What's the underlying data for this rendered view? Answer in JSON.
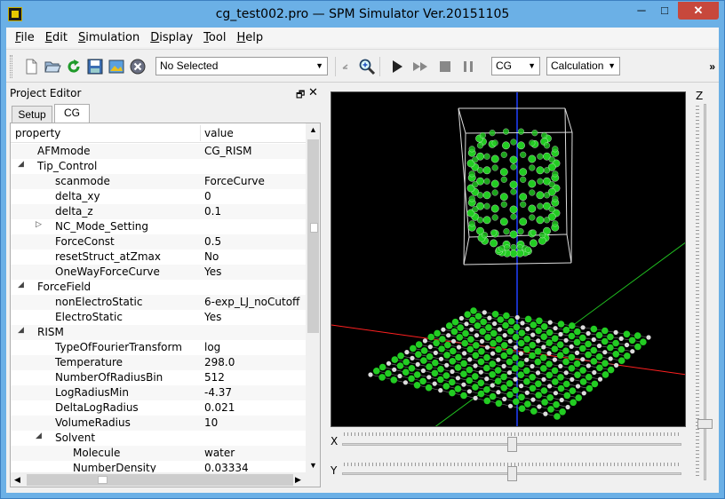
{
  "window": {
    "title": "cg_test002.pro — SPM Simulator Ver.20151105",
    "min_label": "─",
    "max_label": "□",
    "close_label": "✕"
  },
  "menu": {
    "items": [
      {
        "first": "F",
        "rest": "ile"
      },
      {
        "first": "E",
        "rest": "dit"
      },
      {
        "first": "S",
        "rest": "imulation"
      },
      {
        "first": "D",
        "rest": "isplay"
      },
      {
        "first": "T",
        "rest": "ool"
      },
      {
        "first": "H",
        "rest": "elp"
      }
    ]
  },
  "toolbar": {
    "selection_value": "No Selected",
    "method_value": "CG",
    "mode_value": "Calculation",
    "more_label": "»",
    "icons": [
      "new-file-icon",
      "open-folder-icon",
      "reload-icon",
      "save-icon",
      "image-icon",
      "cancel-icon",
      "undo-icon",
      "zoom-icon",
      "play-icon",
      "fast-forward-icon",
      "stop-icon",
      "pause-icon"
    ]
  },
  "panel": {
    "title": "Project Editor",
    "float_label": "🗗",
    "close_label": "✕",
    "tabs": [
      "Setup",
      "CG"
    ],
    "active_tab": "CG",
    "col_property": "property",
    "col_value": "value",
    "rows": [
      {
        "indent": 0,
        "expander": "",
        "property": "AFMmode",
        "value": "CG_RISM"
      },
      {
        "indent": 0,
        "expander": "◢",
        "property": "Tip_Control",
        "value": ""
      },
      {
        "indent": 1,
        "expander": "",
        "property": "scanmode",
        "value": "ForceCurve"
      },
      {
        "indent": 1,
        "expander": "",
        "property": "delta_xy",
        "value": "0"
      },
      {
        "indent": 1,
        "expander": "",
        "property": "delta_z",
        "value": "0.1"
      },
      {
        "indent": 1,
        "expander": "▷",
        "property": "NC_Mode_Setting",
        "value": ""
      },
      {
        "indent": 1,
        "expander": "",
        "property": "ForceConst",
        "value": "0.5"
      },
      {
        "indent": 1,
        "expander": "",
        "property": "resetStruct_atZmax",
        "value": "No"
      },
      {
        "indent": 1,
        "expander": "",
        "property": "OneWayForceCurve",
        "value": "Yes"
      },
      {
        "indent": 0,
        "expander": "◢",
        "property": "ForceField",
        "value": ""
      },
      {
        "indent": 1,
        "expander": "",
        "property": "nonElectroStatic",
        "value": "6-exp_LJ_noCutoff"
      },
      {
        "indent": 1,
        "expander": "",
        "property": "ElectroStatic",
        "value": "Yes"
      },
      {
        "indent": 0,
        "expander": "◢",
        "property": "RISM",
        "value": ""
      },
      {
        "indent": 1,
        "expander": "",
        "property": "TypeOfFourierTransform",
        "value": "log"
      },
      {
        "indent": 1,
        "expander": "",
        "property": "Temperature",
        "value": "298.0"
      },
      {
        "indent": 1,
        "expander": "",
        "property": "NumberOfRadiusBin",
        "value": "512"
      },
      {
        "indent": 1,
        "expander": "",
        "property": "LogRadiusMin",
        "value": "-4.37"
      },
      {
        "indent": 1,
        "expander": "",
        "property": "DeltaLogRadius",
        "value": "0.021"
      },
      {
        "indent": 1,
        "expander": "",
        "property": "VolumeRadius",
        "value": "10"
      },
      {
        "indent": 1,
        "expander": "◢",
        "property": "Solvent",
        "value": ""
      },
      {
        "indent": 2,
        "expander": "",
        "property": "Molecule",
        "value": "water"
      },
      {
        "indent": 2,
        "expander": "",
        "property": "NumberDensity",
        "value": "0.03334"
      }
    ]
  },
  "view": {
    "x_label": "X",
    "y_label": "Y",
    "z_label": "Z",
    "x_slider_fraction": 0.5,
    "y_slider_fraction": 0.5,
    "z_slider_fraction": 0.85,
    "axis_colors": {
      "x": "#ff2020",
      "y": "#20c020",
      "z": "#2040ff"
    },
    "atom_color": "#22cc22",
    "hydrogen_color": "#dddddd"
  }
}
